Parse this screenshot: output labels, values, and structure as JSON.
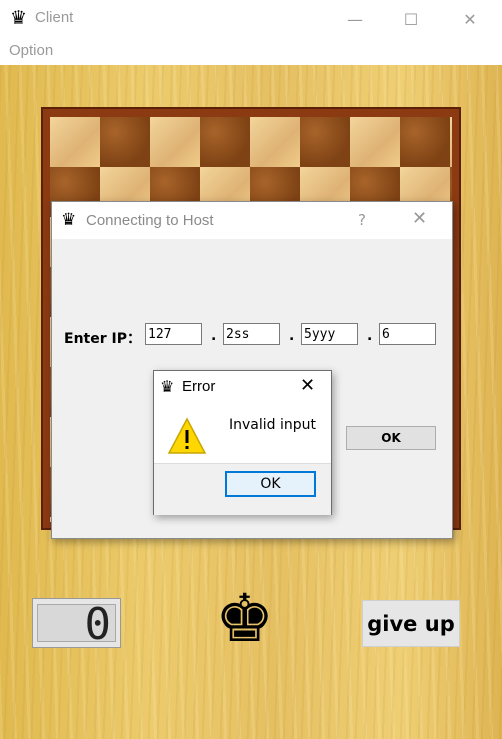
{
  "window": {
    "title": "Client",
    "app_icon": "queen-icon",
    "minimize": "—",
    "maximize": "☐",
    "close": "✕"
  },
  "menu": {
    "items": [
      "Option"
    ]
  },
  "connect_dialog": {
    "title": "Connecting to Host",
    "help": "?",
    "close": "✕",
    "ip_label": "Enter IP：",
    "ip_fields": [
      "127",
      "2ss",
      "5yyy",
      "6"
    ],
    "separator": ".",
    "ok_label": "OK"
  },
  "error_dialog": {
    "title": "Error",
    "close": "✕",
    "message": "Invalid input",
    "ok_label": "OK"
  },
  "bottom": {
    "counter": "0",
    "king_glyph": "♚",
    "give_up_label": "give up"
  }
}
